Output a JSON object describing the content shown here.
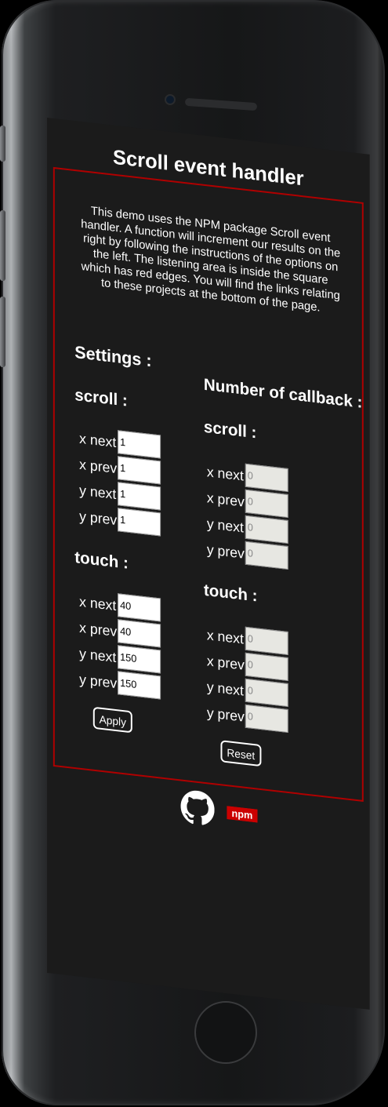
{
  "app": {
    "title": "Scroll event handler",
    "intro": "This demo uses the NPM package Scroll event handler. A function will increment our results on the right by following the instructions of the options on the left. The listening area is inside the square which has red edges. You will find the links relating to these projects at the bottom of the page."
  },
  "settings": {
    "heading": "Settings :",
    "scroll": {
      "heading": "scroll :",
      "fields": [
        {
          "label": "x next",
          "value": "1"
        },
        {
          "label": "x prev",
          "value": "1"
        },
        {
          "label": "y next",
          "value": "1"
        },
        {
          "label": "y prev",
          "value": "1"
        }
      ]
    },
    "touch": {
      "heading": "touch :",
      "fields": [
        {
          "label": "x next",
          "value": "40"
        },
        {
          "label": "x prev",
          "value": "40"
        },
        {
          "label": "y next",
          "value": "150"
        },
        {
          "label": "y prev",
          "value": "150"
        }
      ]
    },
    "apply_label": "Apply"
  },
  "callbacks": {
    "heading": "Number of callback :",
    "scroll": {
      "heading": "scroll :",
      "fields": [
        {
          "label": "x next",
          "value": "0"
        },
        {
          "label": "x prev",
          "value": "0"
        },
        {
          "label": "y next",
          "value": "0"
        },
        {
          "label": "y prev",
          "value": "0"
        }
      ]
    },
    "touch": {
      "heading": "touch :",
      "fields": [
        {
          "label": "x next",
          "value": "0"
        },
        {
          "label": "x prev",
          "value": "0"
        },
        {
          "label": "y next",
          "value": "0"
        },
        {
          "label": "y prev",
          "value": "0"
        }
      ]
    },
    "reset_label": "Reset"
  },
  "footer": {
    "links": [
      {
        "icon": "github-icon"
      },
      {
        "icon": "npm-icon",
        "text": "npm"
      }
    ]
  },
  "colors": {
    "accent_border": "#b00000",
    "background": "#1b1b1b",
    "npm_red": "#cb0000"
  }
}
